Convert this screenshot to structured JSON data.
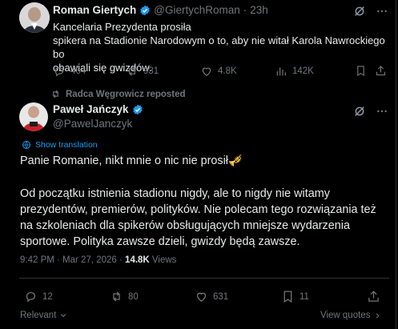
{
  "top_tweet": {
    "author_name": "Roman Giertych",
    "handle": "@GiertychRoman",
    "dot": "·",
    "time": "23h",
    "text_lines": [
      "Kancelaria Prezydenta prosiła",
      "spikera na Stadionie Narodowym o to, aby nie witał Karola Nawrockiego bo",
      "obawiali się gwizdów."
    ],
    "stats": {
      "replies": "464",
      "reposts": "931",
      "likes": "4.8K",
      "views": "142K"
    }
  },
  "repost_line": "Radca Węgrowicz reposted",
  "main_tweet": {
    "author_name": "Paweł Jańczyk",
    "handle": "@PawelJanczyk",
    "show_translation": "Show translation",
    "text_para1": "Panie Romanie, nikt mnie o nic nie prosił🎺",
    "text_para2": "Od początku istnienia stadionu nigdy, ale to nigdy nie witamy prezydentów, premierów, polityków. Nie polecam tego rozwiązania też na szkoleniach dla spikerów obsługujących mniejsze wydarzenia sportowe. Polityka zawsze dzieli, gwizdy będą zawsze.",
    "timestamp": "9:42 PM · Mar 27, 2026 · ",
    "views_count": "14.8K",
    "views_label": " Views",
    "stats": {
      "replies": "12",
      "reposts": "80",
      "likes": "631",
      "bookmarks": "11"
    },
    "relevant_label": "Relevant",
    "view_quotes_label": "View quotes"
  },
  "colors": {
    "accent_blue": "#1d9bf0",
    "verified": "#1d9bf0",
    "muted": "#71767b",
    "text": "#e7e9ea",
    "border": "#2f3336"
  },
  "icons": [
    "verified-badge-icon",
    "grok-icon",
    "more-icon",
    "reply-icon",
    "repost-icon",
    "like-icon",
    "views-icon",
    "bookmark-icon",
    "share-icon",
    "translate-icon",
    "chevron-down-icon",
    "chevron-right-icon"
  ]
}
